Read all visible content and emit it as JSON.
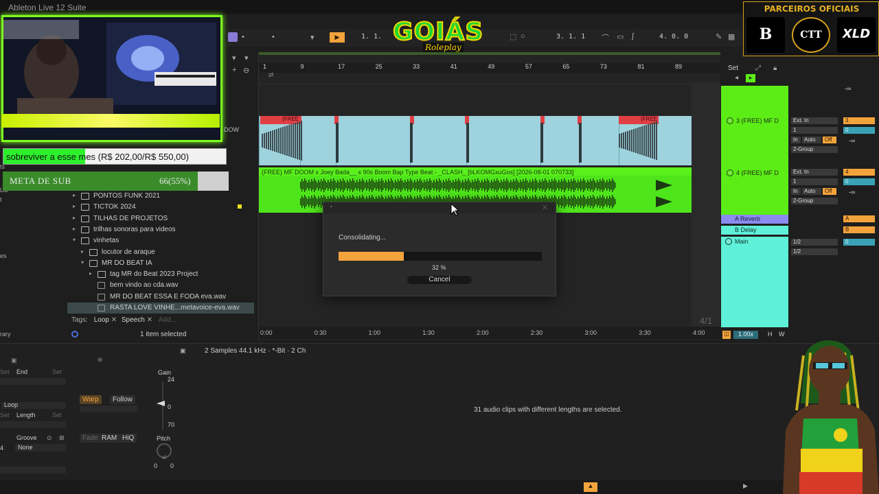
{
  "app": {
    "title": "Ableton Live 12 Suite"
  },
  "transport": {
    "position": "1. 1.",
    "position2": "3. 1. 1",
    "position3": "4. 0. 0"
  },
  "overlay": {
    "logo": {
      "main": "GOIÁS",
      "sub": "Roleplay"
    },
    "partners": {
      "title": "PARCEIROS OFICIAIS",
      "logos": [
        "B",
        "CTT",
        "XLD"
      ]
    },
    "goal_text": "sobrevive​r a esse mes (R$ 202,00/R$ 550,00)",
    "goal_fraction": 0.367,
    "sub_label": "META DE SUB",
    "sub_value": "66(55%)",
    "sub_fraction": 0.55
  },
  "browser": {
    "items": [
      {
        "label": "PONTOS FUNK 2021",
        "type": "folder",
        "indent": 0
      },
      {
        "label": "TICTOK 2024",
        "type": "folder",
        "indent": 0
      },
      {
        "label": "TILHAS DE PROJETOS",
        "type": "folder",
        "indent": 0
      },
      {
        "label": "trilhas sonoras para videos",
        "type": "folder",
        "indent": 0
      },
      {
        "label": "vinhetas",
        "type": "folder",
        "indent": 0
      },
      {
        "label": "locutor de araque",
        "type": "folder",
        "indent": 1
      },
      {
        "label": "MR DO BEAT  IA",
        "type": "folder",
        "indent": 1
      },
      {
        "label": "tag MR do Beat 2023 Project",
        "type": "project",
        "indent": 2
      },
      {
        "label": "bem vindo ao cda.wav",
        "type": "file",
        "indent": 2
      },
      {
        "label": "MR DO BEAT ESSA E FODA eva.wav",
        "type": "file",
        "indent": 2
      },
      {
        "label": "RASTA LOVE VINHE...metavoice-eva.wav",
        "type": "file",
        "indent": 2,
        "selected": true
      }
    ],
    "tags_label": "Tags:",
    "tags": [
      "Loop",
      "Speech"
    ],
    "tags_add": "Add...",
    "selected_info": "1 item selected",
    "library_label": "rary"
  },
  "arrangement": {
    "bars": [
      "1",
      "9",
      "17",
      "25",
      "33",
      "41",
      "49",
      "57",
      "65",
      "73",
      "81",
      "89"
    ],
    "times": [
      "0:00",
      "0:30",
      "1:00",
      "1:30",
      "2:00",
      "2:30",
      "3:00",
      "3:30",
      "4:00"
    ],
    "clip_title": "(FREE) MF DOOM x Joey Bada__ x 90s Boom Bap Type Beat - _CLASH_ [bLKOMGxuGos] [2026-08-01 070733]",
    "marker_label": "(FREE",
    "signature": "4/1"
  },
  "mixer": {
    "set_label": "Set",
    "tracks": [
      {
        "name": "3 (FREE) MF D",
        "input": "Ext. In",
        "channel": "1",
        "monitor": [
          "In",
          "Auto",
          "Off"
        ],
        "routing": "2-Group",
        "number": "3",
        "volume": "0",
        "pan": "-∞"
      },
      {
        "name": "4 (FREE) MF D",
        "input": "Ext. In",
        "channel": "1",
        "monitor": [
          "In",
          "Auto",
          "Off"
        ],
        "routing": "2-Group",
        "number": "4",
        "volume": "0",
        "pan": "-∞"
      }
    ],
    "returns": [
      {
        "name": "A Reverb",
        "letter": "A"
      },
      {
        "name": "B Delay",
        "letter": "B"
      }
    ],
    "main": {
      "name": "Main",
      "out1": "1/2",
      "out2": "1/2",
      "volume": "0"
    },
    "zoom": "1.00x",
    "hw": [
      "H",
      "W"
    ],
    "top_value": "-∞"
  },
  "dialog": {
    "message": "Consolidating...",
    "percent_label": "32 %",
    "progress": 0.32,
    "cancel_label": "Cancel"
  },
  "clip_view": {
    "info": "2 Samples 44.1 kHz · *-Bit · 2 Ch",
    "message": "31 audio clips with different lengths are selected.",
    "end_label": "End",
    "set_label": "Set",
    "loop_label": "Loop",
    "length_label": "Length",
    "groove_label": "Groove",
    "groove_value": "None",
    "warp_label": "Warp",
    "follow_label": "Follow",
    "fade_label": "Fade",
    "ram_label": "RAM",
    "hiq_label": "HiQ",
    "gain_label": "Gain",
    "gain_top": "24",
    "gain_mid": "0",
    "gain_bottom": "70",
    "pitch_label": "Pitch",
    "pitch_unit": "st",
    "pitch_values": [
      "0",
      "0"
    ],
    "left_value": "4"
  },
  "colors": {
    "accent": "#f3a33c",
    "green_track": "#5af01c",
    "blue_track": "#a8dbe6",
    "return_a": "#8a8cf0",
    "return_b": "#5ef0d8"
  }
}
